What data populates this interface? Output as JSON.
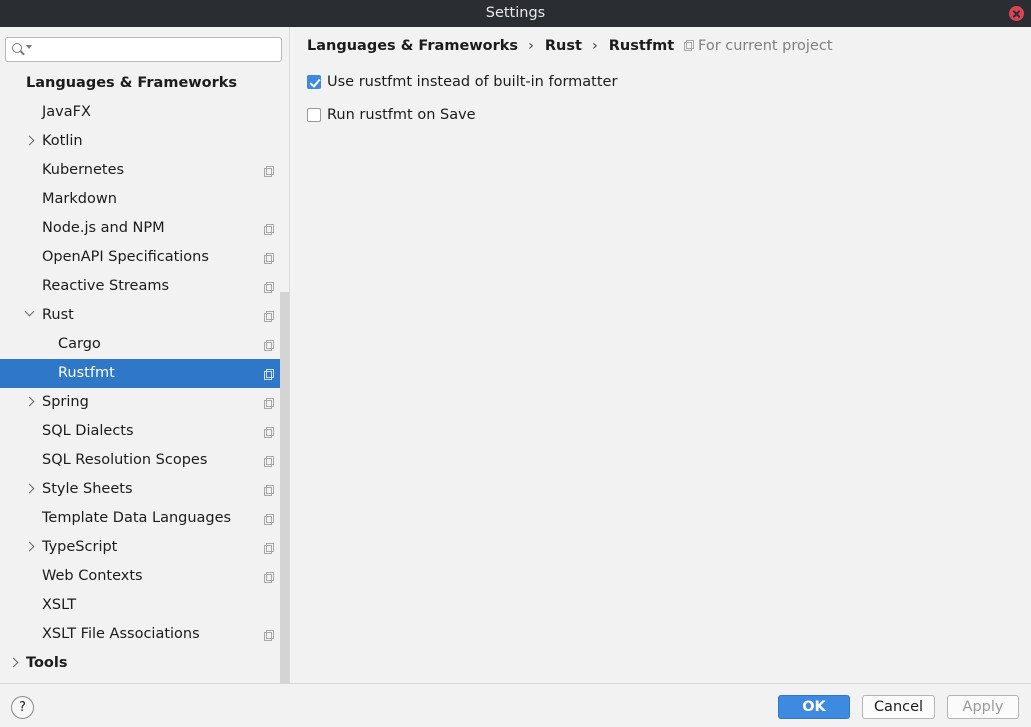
{
  "window": {
    "title": "Settings"
  },
  "sidebar": {
    "search": {
      "placeholder": "",
      "value": ""
    },
    "items": [
      {
        "label": "Languages & Frameworks",
        "level": 0,
        "bold": true,
        "chevron": "none",
        "project_icon": false,
        "selected": false
      },
      {
        "label": "JavaFX",
        "level": 1,
        "bold": false,
        "chevron": "none",
        "project_icon": false,
        "selected": false
      },
      {
        "label": "Kotlin",
        "level": 1,
        "bold": false,
        "chevron": "right",
        "project_icon": false,
        "selected": false
      },
      {
        "label": "Kubernetes",
        "level": 1,
        "bold": false,
        "chevron": "none",
        "project_icon": true,
        "selected": false
      },
      {
        "label": "Markdown",
        "level": 1,
        "bold": false,
        "chevron": "none",
        "project_icon": false,
        "selected": false
      },
      {
        "label": "Node.js and NPM",
        "level": 1,
        "bold": false,
        "chevron": "none",
        "project_icon": true,
        "selected": false
      },
      {
        "label": "OpenAPI Specifications",
        "level": 1,
        "bold": false,
        "chevron": "none",
        "project_icon": true,
        "selected": false
      },
      {
        "label": "Reactive Streams",
        "level": 1,
        "bold": false,
        "chevron": "none",
        "project_icon": true,
        "selected": false
      },
      {
        "label": "Rust",
        "level": 1,
        "bold": false,
        "chevron": "down",
        "project_icon": true,
        "selected": false
      },
      {
        "label": "Cargo",
        "level": 2,
        "bold": false,
        "chevron": "none",
        "project_icon": true,
        "selected": false
      },
      {
        "label": "Rustfmt",
        "level": 2,
        "bold": false,
        "chevron": "none",
        "project_icon": true,
        "selected": true
      },
      {
        "label": "Spring",
        "level": 1,
        "bold": false,
        "chevron": "right",
        "project_icon": true,
        "selected": false
      },
      {
        "label": "SQL Dialects",
        "level": 1,
        "bold": false,
        "chevron": "none",
        "project_icon": true,
        "selected": false
      },
      {
        "label": "SQL Resolution Scopes",
        "level": 1,
        "bold": false,
        "chevron": "none",
        "project_icon": true,
        "selected": false
      },
      {
        "label": "Style Sheets",
        "level": 1,
        "bold": false,
        "chevron": "right",
        "project_icon": true,
        "selected": false
      },
      {
        "label": "Template Data Languages",
        "level": 1,
        "bold": false,
        "chevron": "none",
        "project_icon": true,
        "selected": false
      },
      {
        "label": "TypeScript",
        "level": 1,
        "bold": false,
        "chevron": "right",
        "project_icon": true,
        "selected": false
      },
      {
        "label": "Web Contexts",
        "level": 1,
        "bold": false,
        "chevron": "none",
        "project_icon": true,
        "selected": false
      },
      {
        "label": "XSLT",
        "level": 1,
        "bold": false,
        "chevron": "none",
        "project_icon": false,
        "selected": false
      },
      {
        "label": "XSLT File Associations",
        "level": 1,
        "bold": false,
        "chevron": "none",
        "project_icon": true,
        "selected": false
      },
      {
        "label": "Tools",
        "level": 0,
        "bold": true,
        "chevron": "right",
        "project_icon": false,
        "selected": false
      }
    ]
  },
  "content": {
    "breadcrumb": [
      "Languages & Frameworks",
      "Rust",
      "Rustfmt"
    ],
    "breadcrumb_separator": "›",
    "scope_label": "For current project",
    "options": [
      {
        "label": "Use rustfmt instead of built-in formatter",
        "checked": true
      },
      {
        "label": "Run rustfmt on Save",
        "checked": false
      }
    ]
  },
  "footer": {
    "help_label": "?",
    "ok_label": "OK",
    "cancel_label": "Cancel",
    "apply_label": "Apply"
  },
  "colors": {
    "selection": "#2f77c7",
    "accent": "#3d8ae0",
    "titlebar": "#2a2e32",
    "close": "#da4453"
  },
  "icons": {
    "search": "search-icon",
    "close": "close-icon",
    "project_scope": "project-scope-icon",
    "expand": "chevron-right-icon",
    "collapse": "chevron-down-icon"
  }
}
